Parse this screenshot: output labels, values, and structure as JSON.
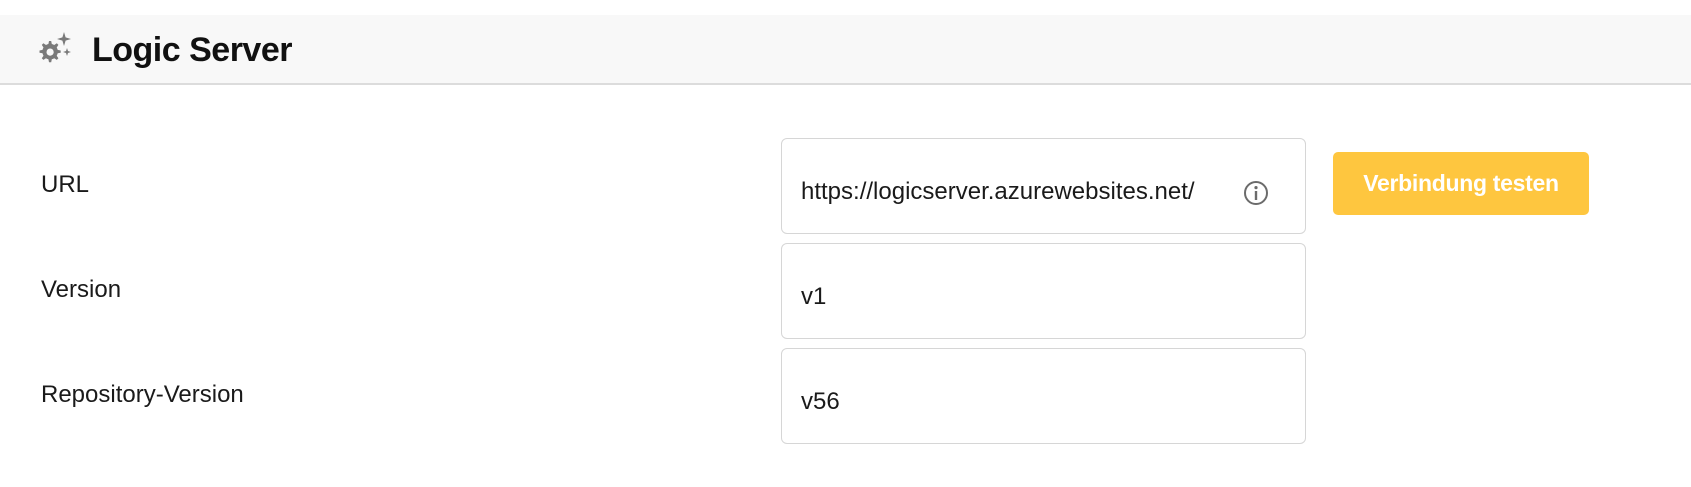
{
  "header": {
    "title": "Logic Server",
    "icon": "gear-sparkle-icon"
  },
  "form": {
    "rows": [
      {
        "label": "URL",
        "value": "https://logicserver.azurewebsites.net/",
        "icon": "info-icon"
      },
      {
        "label": "Version",
        "value": "v1"
      },
      {
        "label": "Repository-Version",
        "value": "v56"
      }
    ],
    "test_button_label": "Verbindung testen"
  },
  "colors": {
    "accent": "#fec63f",
    "header_bg": "#f8f8f8",
    "border": "#d6d6d6",
    "icon_gray": "#7a7a7a"
  }
}
